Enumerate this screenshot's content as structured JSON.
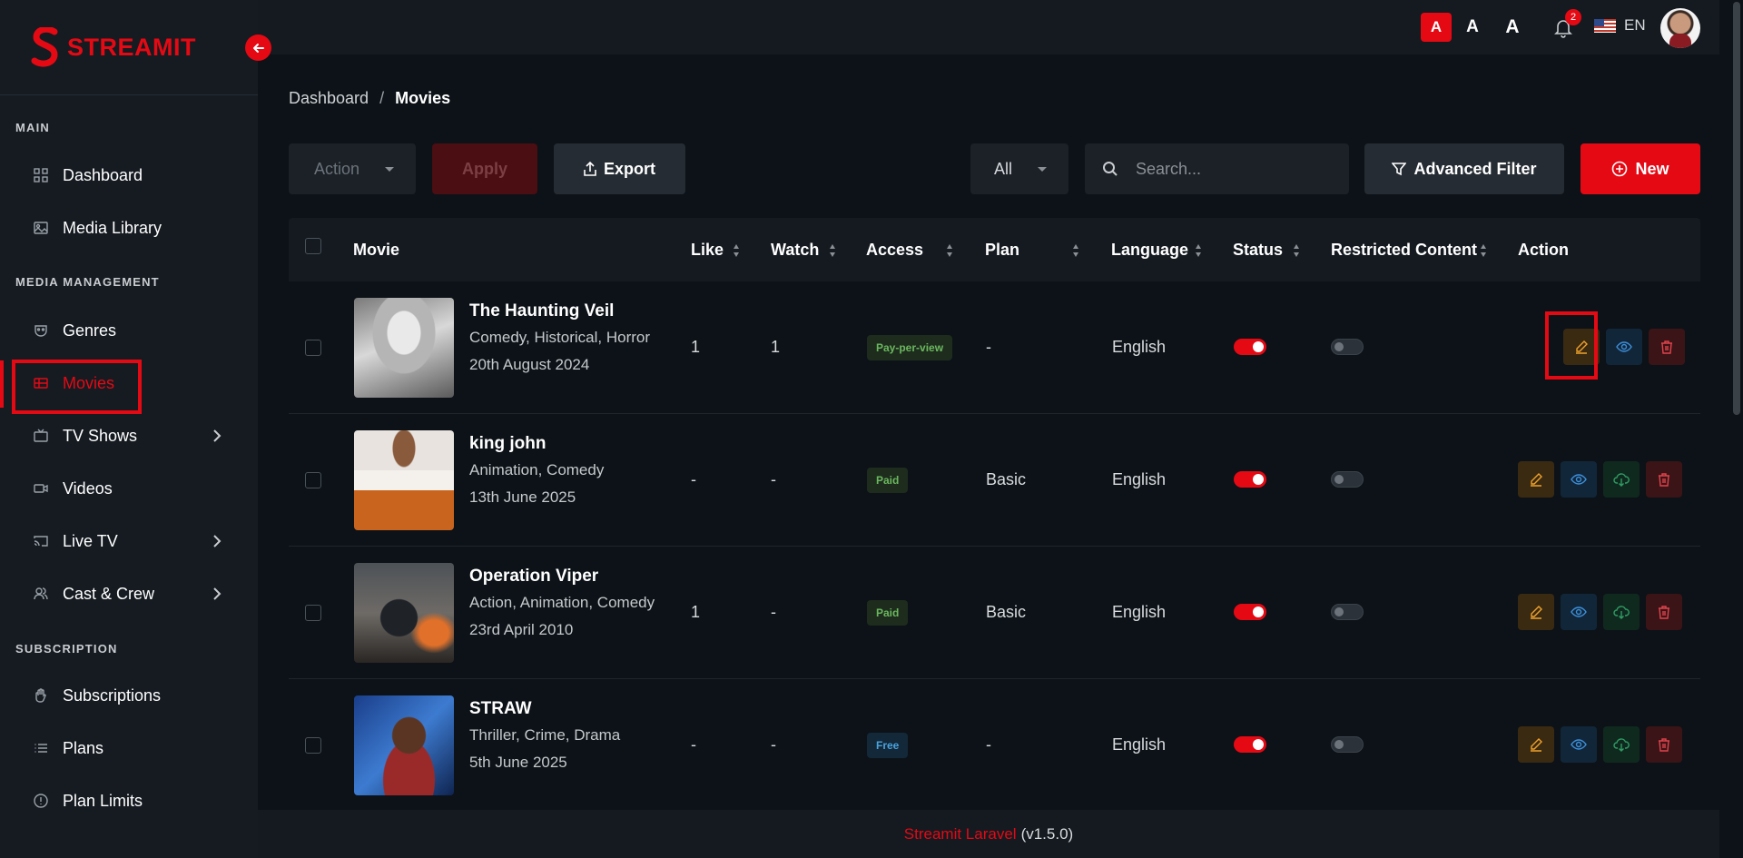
{
  "app": {
    "brand": "STREAMIT"
  },
  "sidebar": {
    "sections": [
      {
        "title": "MAIN"
      },
      {
        "title": "MEDIA MANAGEMENT"
      },
      {
        "title": "SUBSCRIPTION"
      }
    ],
    "items": [
      {
        "label": "Dashboard",
        "icon": "grid-icon"
      },
      {
        "label": "Media Library",
        "icon": "image-icon"
      },
      {
        "label": "Genres",
        "icon": "mask-icon"
      },
      {
        "label": "Movies",
        "icon": "film-icon",
        "active": true
      },
      {
        "label": "TV Shows",
        "icon": "tv-icon",
        "has_children": true
      },
      {
        "label": "Videos",
        "icon": "video-icon"
      },
      {
        "label": "Live TV",
        "icon": "cast-icon",
        "has_children": true
      },
      {
        "label": "Cast & Crew",
        "icon": "users-icon",
        "has_children": true
      },
      {
        "label": "Subscriptions",
        "icon": "hand-icon"
      },
      {
        "label": "Plans",
        "icon": "list-icon"
      },
      {
        "label": "Plan Limits",
        "icon": "info-icon"
      }
    ]
  },
  "header": {
    "font_sizes": [
      "A",
      "A",
      "A"
    ],
    "notification_count": "2",
    "language": "EN"
  },
  "breadcrumb": {
    "home": "Dashboard",
    "separator": "/",
    "current": "Movies"
  },
  "toolbar": {
    "action_select": "Action",
    "apply": "Apply",
    "export": "Export",
    "filter_select": "All",
    "search_placeholder": "Search...",
    "advanced_filter": "Advanced Filter",
    "new": "New"
  },
  "table": {
    "columns": [
      "Movie",
      "Like",
      "Watch",
      "Access",
      "Plan",
      "Language",
      "Status",
      "Restricted Content",
      "Action"
    ],
    "rows": [
      {
        "title": "The Haunting Veil",
        "genres": "Comedy, Historical, Horror",
        "date": "20th August 2024",
        "like": "1",
        "watch": "1",
        "access": "Pay-per-view",
        "plan": "-",
        "language": "English",
        "status": true,
        "restricted": false,
        "actions": [
          "edit",
          "view",
          "delete"
        ]
      },
      {
        "title": "king john",
        "genres": "Animation, Comedy",
        "date": "13th June 2025",
        "like": "-",
        "watch": "-",
        "access": "Paid",
        "plan": "Basic",
        "language": "English",
        "status": true,
        "restricted": false,
        "actions": [
          "edit",
          "view",
          "download",
          "delete"
        ]
      },
      {
        "title": "Operation Viper",
        "genres": "Action, Animation, Comedy",
        "date": "23rd April 2010",
        "like": "1",
        "watch": "-",
        "access": "Paid",
        "plan": "Basic",
        "language": "English",
        "status": true,
        "restricted": false,
        "actions": [
          "edit",
          "view",
          "download",
          "delete"
        ]
      },
      {
        "title": "STRAW",
        "genres": "Thriller, Crime, Drama",
        "date": "5th June 2025",
        "like": "-",
        "watch": "-",
        "access": "Free",
        "plan": "-",
        "language": "English",
        "status": true,
        "restricted": false,
        "actions": [
          "edit",
          "view",
          "download",
          "delete"
        ]
      }
    ]
  },
  "footer": {
    "brand_link": "Streamit Laravel",
    "version": "(v1.5.0)"
  },
  "colors": {
    "accent": "#e50914",
    "background": "#0c1217",
    "sidebar": "#151b21"
  }
}
